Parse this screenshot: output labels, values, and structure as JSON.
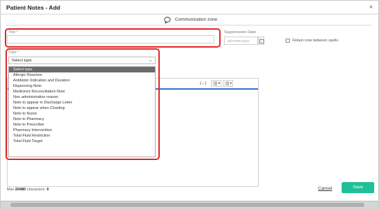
{
  "header": {
    "title": "Patient Notes - Add",
    "close": "×"
  },
  "comm_zone": {
    "label": "Communication zone"
  },
  "form": {
    "title_label": "Title *",
    "title_value": "",
    "suppression_label": "Suppression Date",
    "suppression_placeholder": "dd-mmm-yyyy",
    "retain_label": "Retain note between spells",
    "type_label": "Type *",
    "type_selected": "Select type",
    "type_chevron": "⌄"
  },
  "type_options": [
    "Select type",
    "Allergic Reaction",
    "Antibiotic Indication and Duration",
    "Dispensing Note",
    "Medicines Reconciliation Note",
    "Non administration reason",
    "Note to appear in Discharge Letter",
    "Note to appear when Charting",
    "Note to Nurse",
    "Note to Pharmacy",
    "Note to Prescriber",
    "Pharmacy Intervention",
    "Total Fluid Restriction",
    "Total Fluid Target"
  ],
  "editor": {
    "tool_code": "{↔}",
    "max_label": "Max",
    "max_value": "20480",
    "chars_label": "characters:",
    "chars_value": "0"
  },
  "actions": {
    "cancel": "Cancel",
    "save": "Save"
  }
}
